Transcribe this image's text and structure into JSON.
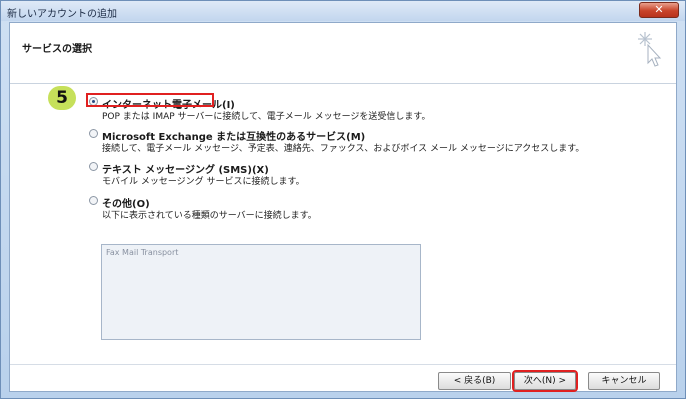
{
  "window": {
    "title": "新しいアカウントの追加",
    "close_glyph": "✕"
  },
  "header": {
    "title": "サービスの選択"
  },
  "step_badge": "5",
  "options": [
    {
      "label": "インターネット電子メール(I)",
      "desc": "POP または IMAP サーバーに接続して、電子メール メッセージを送受信します。",
      "selected": true
    },
    {
      "label": "Microsoft Exchange または互換性のあるサービス(M)",
      "desc": "接続して、電子メール メッセージ、予定表、連絡先、ファックス、およびボイス メール メッセージにアクセスします。",
      "selected": false
    },
    {
      "label": "テキスト メッセージング (SMS)(X)",
      "desc": "モバイル メッセージング サービスに接続します。",
      "selected": false
    },
    {
      "label": "その他(O)",
      "desc": "以下に表示されている種類のサーバーに接続します。",
      "selected": false
    }
  ],
  "transport_list": [
    "Fax Mail Transport"
  ],
  "buttons": {
    "back": "< 戻る(B)",
    "next": "次へ(N) >",
    "cancel": "キャンセル"
  },
  "colors": {
    "highlight": "#e02020",
    "badge": "#c6e05a",
    "close": "#c8432a"
  },
  "icons": {
    "wizard": "sparkle-cursor-icon"
  }
}
